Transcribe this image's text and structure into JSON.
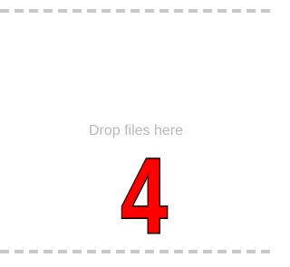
{
  "dropzone": {
    "prompt": "Drop files here",
    "count": "4",
    "colors": {
      "dash": "#c8c8c8",
      "prompt_text": "#b8b8b8",
      "badge_fill": "#ff0000",
      "badge_outline": "#000000"
    }
  }
}
